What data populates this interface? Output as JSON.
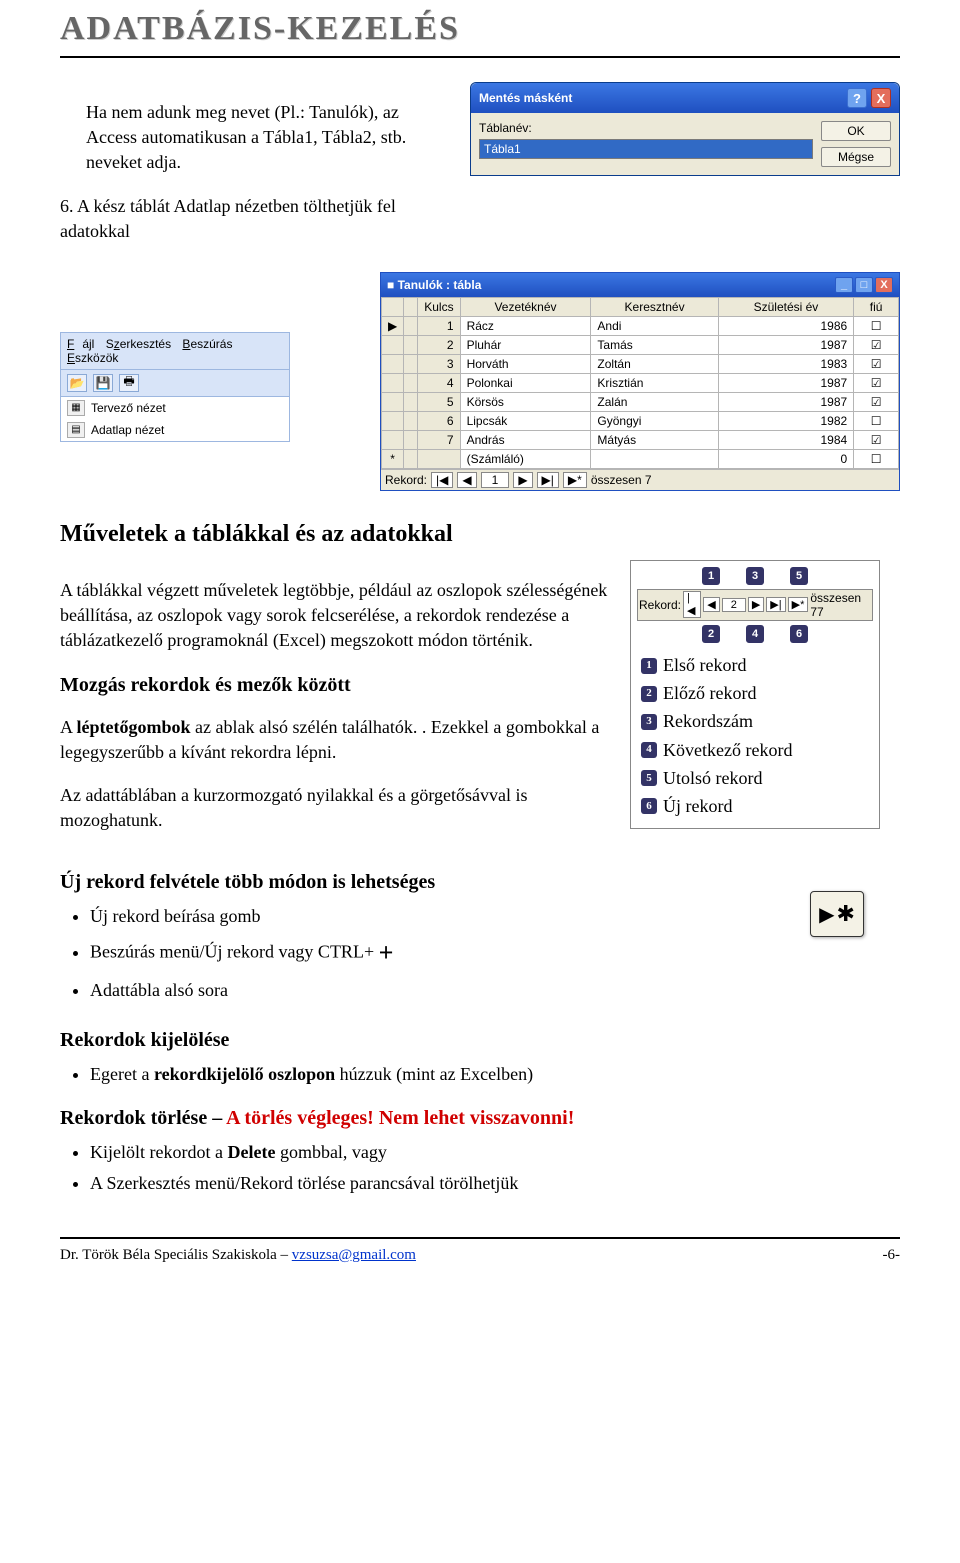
{
  "header": {
    "title": "ADATBÁZIS-KEZELÉS"
  },
  "intro": {
    "para1": "Ha nem adunk meg nevet (Pl.: Tanulók), az Access automatikusan a Tábla1, Tábla2, stb. neveket adja.",
    "item6": "A kész táblát Adatlap nézetben tölthetjük fel adatokkal"
  },
  "dialog": {
    "title": "Mentés másként",
    "label": "Táblanév:",
    "value": "Tábla1",
    "ok": "OK",
    "cancel": "Mégse",
    "help": "?",
    "close": "X"
  },
  "tablewin": {
    "title": "Tanulók : tábla",
    "min": "_",
    "max": "□",
    "close": "X",
    "headers": [
      "",
      "",
      "Kulcs",
      "Vezetéknév",
      "Keresztnév",
      "Születési év",
      "fiú"
    ],
    "rows": [
      {
        "sel": "▶",
        "n": "1",
        "vez": "Rácz",
        "ker": "Andi",
        "ev": "1986",
        "fiu": false
      },
      {
        "sel": "",
        "n": "2",
        "vez": "Pluhár",
        "ker": "Tamás",
        "ev": "1987",
        "fiu": true
      },
      {
        "sel": "",
        "n": "3",
        "vez": "Horváth",
        "ker": "Zoltán",
        "ev": "1983",
        "fiu": true
      },
      {
        "sel": "",
        "n": "4",
        "vez": "Polonkai",
        "ker": "Krisztián",
        "ev": "1987",
        "fiu": true
      },
      {
        "sel": "",
        "n": "5",
        "vez": "Körsös",
        "ker": "Zalán",
        "ev": "1987",
        "fiu": true
      },
      {
        "sel": "",
        "n": "6",
        "vez": "Lipcsák",
        "ker": "Gyöngyi",
        "ev": "1982",
        "fiu": false
      },
      {
        "sel": "",
        "n": "7",
        "vez": "András",
        "ker": "Mátyás",
        "ev": "1984",
        "fiu": true
      }
    ],
    "newrow": {
      "sel": "*",
      "n": "",
      "vez": "(Számláló)",
      "ker": "",
      "ev": "0",
      "fiu": false
    },
    "footer": {
      "label": "Rekord:",
      "pos": "1",
      "total": "összesen 7"
    }
  },
  "appbit": {
    "menu": [
      "Fájl",
      "Szerkesztés",
      "Beszúrás",
      "Eszközök"
    ],
    "views": [
      {
        "icon": "▦",
        "label": "Tervező nézet"
      },
      {
        "icon": "▤",
        "label": "Adatlap nézet"
      }
    ]
  },
  "section1": {
    "title": "Műveletek a táblákkal és az adatokkal",
    "para": "A táblákkal végzett műveletek legtöbbje, például az oszlopok szélességének beállítása, az oszlopok vagy sorok felcserélése, a rekordok rendezése a táblázatkezelő programoknál (Excel) megszokott módon történik."
  },
  "subsection1": {
    "title": "Mozgás rekordok és mezők között",
    "para1a": "A ",
    "para1b": "léptetőgombok",
    "para1c": " az ablak alsó szélén találhatók. . Ezekkel a gombokkal a legegyszerűbb a kívánt rekordra lépni.",
    "para2": "Az adattáblában a kurzormozgató nyilakkal és a görgetősávval is mozoghatunk."
  },
  "recnav": {
    "top": [
      "1",
      "3",
      "5"
    ],
    "bar": {
      "label": "Rekord:",
      "first": "|◀",
      "prev": "◀",
      "pos": "2",
      "next": "▶",
      "last": "▶|",
      "new": "▶*",
      "total": "összesen 77"
    },
    "bot": [
      "2",
      "4",
      "6"
    ],
    "legend": [
      "Első rekord",
      "Előző rekord",
      "Rekordszám",
      "Következő rekord",
      "Utolsó rekord",
      "Új rekord"
    ]
  },
  "subsection2": {
    "title": "Új rekord felvétele több módon is lehetséges",
    "items": [
      "Új rekord beírása gomb",
      "Beszúrás menü/Új rekord vagy CTRL+",
      "Adattábla alsó sora"
    ],
    "plus": "+"
  },
  "subsection3": {
    "title": "Rekordok kijelölése",
    "item1a": "Egeret a ",
    "item1b": "rekordkijelölő oszlopon",
    "item1c": " húzzuk (mint az Excelben)"
  },
  "subsection4": {
    "title1": "Rekordok törlése – ",
    "title2": "A törlés végleges! Nem lehet visszavonni!",
    "item1a": "Kijelölt rekordot a ",
    "item1b": "Delete",
    "item1c": " gombbal, vagy",
    "item2": "A Szerkesztés menü/Rekord törlése parancsával törölhetjük"
  },
  "footer": {
    "left1": "Dr. Török Béla Speciális Szakiskola – ",
    "email": "vzsuzsa@gmail.com",
    "pagenum": "-6-"
  }
}
